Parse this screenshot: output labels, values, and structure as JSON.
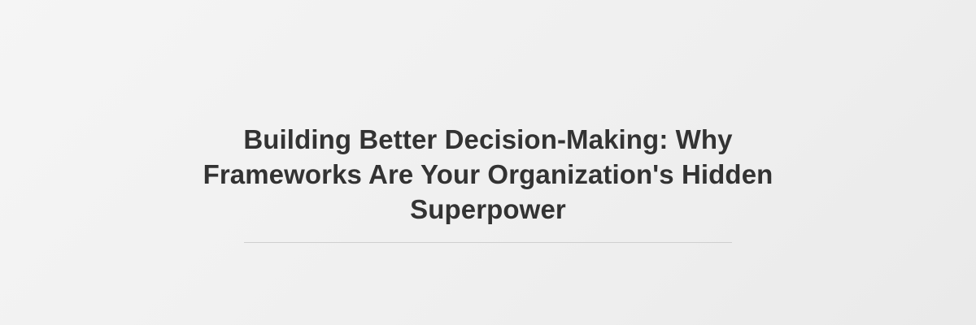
{
  "header": {
    "title_line_1": "Building Better Decision-Making: Why",
    "title_line_2": "Frameworks Are Your Organization's Hidden",
    "title_line_3": "Superpower"
  },
  "colors": {
    "title": "#333333",
    "divider": "#cfcfcf",
    "background": "#f0f0f0"
  }
}
